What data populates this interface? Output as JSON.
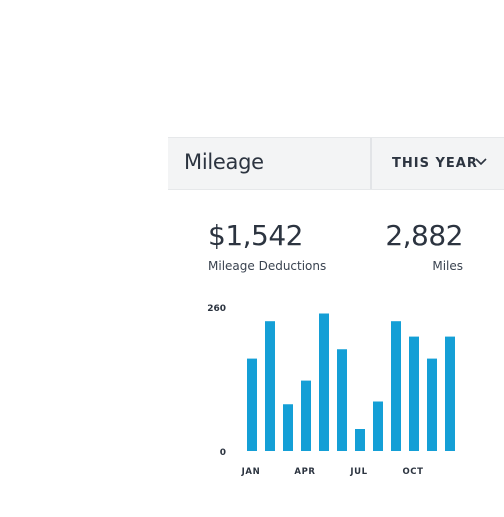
{
  "card": {
    "title": "Mileage",
    "period": {
      "selected": "THIS YEAR",
      "icon": "chevron-down-icon"
    }
  },
  "stats": {
    "deductions": {
      "value": "$1,542",
      "label": "Mileage Deductions"
    },
    "miles": {
      "value": "2,882",
      "label": "Miles"
    }
  },
  "colors": {
    "bar": "#149fd6",
    "header_bg": "#f3f4f5"
  },
  "chart_data": {
    "type": "bar",
    "categories": [
      "JAN",
      "FEB",
      "MAR",
      "APR",
      "MAY",
      "JUN",
      "JUL",
      "AUG",
      "SEP",
      "OCT",
      "NOV",
      "DEC"
    ],
    "tick_labels": [
      "JAN",
      "APR",
      "JUL",
      "OCT"
    ],
    "values": [
      168,
      236,
      85,
      128,
      250,
      185,
      40,
      90,
      236,
      208,
      168,
      208
    ],
    "ylim": [
      0,
      260
    ],
    "y_ticks": [
      "260",
      "0"
    ],
    "grid": false
  }
}
